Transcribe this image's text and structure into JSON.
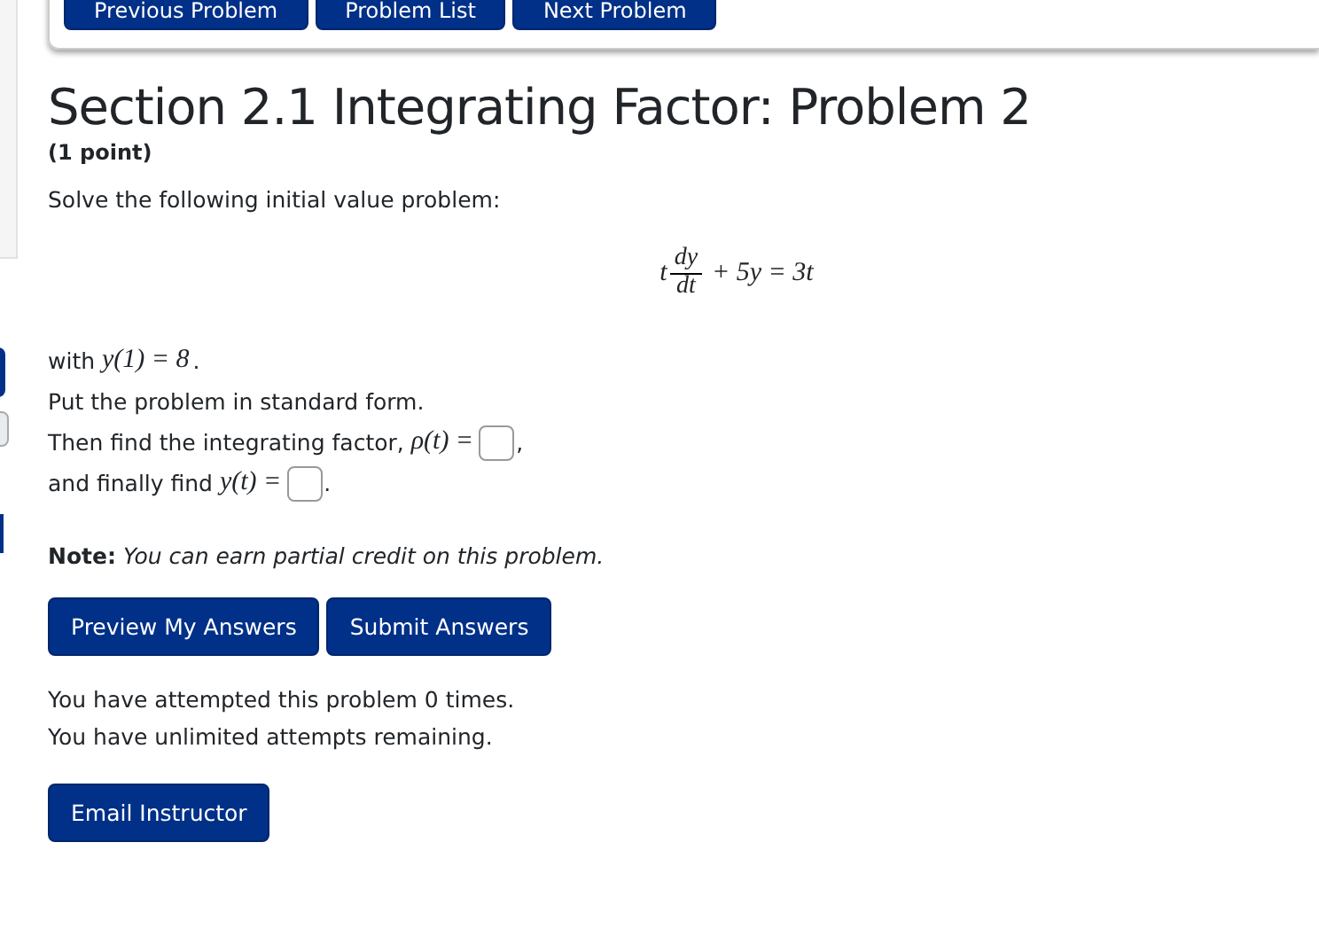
{
  "nav_buttons": [
    "Previous Problem",
    "Problem List",
    "Next Problem"
  ],
  "title": "Section 2.1 Integrating Factor: Problem 2",
  "points": "(1 point)",
  "intro": "Solve the following initial value problem:",
  "equation": {
    "coefficient": "t",
    "numerator": "dy",
    "denominator": "dt",
    "rest": "+ 5y = 3t"
  },
  "lines": [
    [
      {
        "kind": "text",
        "text": "with "
      },
      {
        "kind": "math",
        "text": "y(1) = 8"
      },
      {
        "kind": "text",
        "text": "."
      }
    ],
    [
      {
        "kind": "text",
        "text": "Put the problem in standard form."
      }
    ],
    [
      {
        "kind": "text",
        "text": "Then find the integrating factor, "
      },
      {
        "kind": "math",
        "text": "ρ(t) ="
      },
      {
        "kind": "field"
      },
      {
        "kind": "text",
        "text": ","
      }
    ],
    [
      {
        "kind": "text",
        "text": "and finally find "
      },
      {
        "kind": "math",
        "text": "y(t) ="
      },
      {
        "kind": "field"
      },
      {
        "kind": "text",
        "text": "."
      }
    ]
  ],
  "note": {
    "label": "Note:",
    "text": "You can earn partial credit on this problem."
  },
  "action_buttons": [
    "Preview My Answers",
    "Submit Answers"
  ],
  "attempts": [
    "You have attempted this problem 0 times.",
    "You have unlimited attempts remaining."
  ],
  "email_button": "Email Instructor"
}
